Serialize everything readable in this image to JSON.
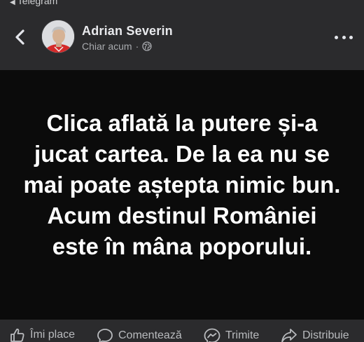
{
  "status_bar": {
    "back_app": "Telegram"
  },
  "header": {
    "author": "Adrian Severin",
    "time": "Chiar acum",
    "separator": "·"
  },
  "post": {
    "text": "Clica aflată la putere și-a jucat cartea. De la ea nu se mai poate aștepta nimic bun. Acum destinul României este în mâna poporului."
  },
  "actions": {
    "like": "Îmi place",
    "comment": "Comentează",
    "send": "Trimite",
    "share": "Distribuie"
  },
  "icons": {
    "back": "chevron-left-icon",
    "privacy": "globe-icon",
    "more": "more-dots-icon",
    "like": "thumbs-up-icon",
    "comment": "comment-bubble-icon",
    "send": "messenger-icon",
    "share": "share-arrow-icon"
  },
  "colors": {
    "header_bg": "#2b2b2d",
    "post_bg": "#0b0b0b",
    "post_text": "#ffffff",
    "secondary_text": "#a8aaae"
  }
}
